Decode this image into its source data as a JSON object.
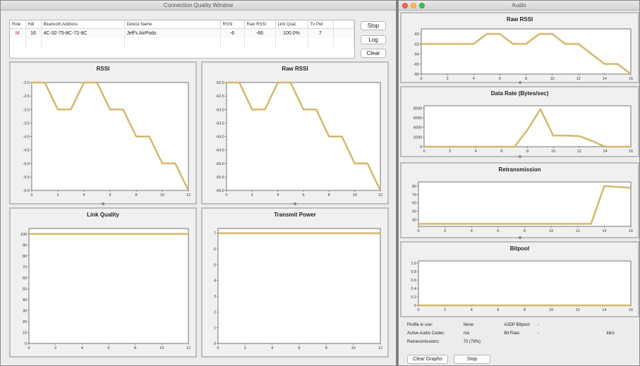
{
  "left_window": {
    "title": "Connection Quality Window",
    "columns": [
      "Role",
      "Hdl",
      "Bluetooth Address",
      "Device Name",
      "RSSI",
      "Raw RSSI",
      "Link Qual.",
      "Tx Pwr"
    ],
    "rows": [
      [
        "M",
        "16",
        "4C-32-75-8C-72-9C",
        "Jeff's AirPods",
        "-6",
        "-66",
        "100.0%",
        "7"
      ]
    ],
    "buttons": {
      "stop": "Stop",
      "log": "Log",
      "clear": "Clear"
    }
  },
  "right_window": {
    "title": "Audio",
    "info": {
      "profile_label": "Profile in use:",
      "profile_value": "None",
      "bitpool_label": "A2DP Bitpool:",
      "bitpool_value": "-",
      "codec_label": "Active Audio Codec:",
      "codec_value": "n/a",
      "bitrate_label": "Bit Rate:",
      "bitrate_value": "-",
      "bitrate_unit": "kb/s",
      "retrans_label": "Retransmissions:",
      "retrans_value": "70 (79%)"
    },
    "buttons": {
      "clear_graphs": "Clear Graphs",
      "stop": "Stop"
    }
  },
  "colors": {
    "line": "#dcc27a",
    "line_core": "#c9a64f"
  },
  "chart_data": [
    {
      "id": "rssi",
      "type": "line",
      "title": "RSSI",
      "x": [
        0,
        1,
        2,
        3,
        4,
        5,
        6,
        7,
        8,
        9,
        10,
        11,
        12
      ],
      "y": [
        -2.0,
        -2.0,
        -3.0,
        -3.0,
        -2.0,
        -2.0,
        -3.0,
        -3.0,
        -4.0,
        -4.0,
        -5.0,
        -5.0,
        -6.0
      ],
      "xlim": [
        0,
        12
      ],
      "ylim": [
        -6.0,
        -2.0
      ],
      "xticks": [
        0,
        2,
        4,
        6,
        8,
        10,
        12
      ],
      "yticks": [
        -2.0,
        -2.5,
        -3.0,
        -3.5,
        -4.0,
        -4.5,
        -5.0,
        -5.5,
        -6.0
      ],
      "ytick_labels": [
        "-2.0",
        "-2.5",
        "-3.0",
        "-3.5",
        "-4.0",
        "-4.5",
        "-5.0",
        "-5.5",
        "-6.0"
      ]
    },
    {
      "id": "rawrssi",
      "type": "line",
      "title": "Raw RSSI",
      "x": [
        0,
        1,
        2,
        3,
        4,
        5,
        6,
        7,
        8,
        9,
        10,
        11,
        12
      ],
      "y": [
        -62,
        -62,
        -63,
        -63,
        -62,
        -62,
        -63,
        -63,
        -64,
        -64,
        -65,
        -65,
        -66
      ],
      "xlim": [
        0,
        12
      ],
      "ylim": [
        -66,
        -62
      ],
      "xticks": [
        0,
        2,
        4,
        6,
        8,
        10,
        12
      ],
      "yticks": [
        -62,
        -62.5,
        -63,
        -63.5,
        -64,
        -64.5,
        -65,
        -65.5,
        -66
      ],
      "ytick_labels": [
        "-62.0",
        "-62.5",
        "-63.0",
        "-63.5",
        "-64.0",
        "-64.5",
        "-65.0",
        "-65.5",
        "-66.0"
      ]
    },
    {
      "id": "linkq",
      "type": "line",
      "title": "Link Quality",
      "x": [
        0,
        12
      ],
      "y": [
        100,
        100
      ],
      "xlim": [
        0,
        12
      ],
      "ylim": [
        0,
        105
      ],
      "xticks": [
        0,
        2,
        4,
        6,
        8,
        10,
        12
      ],
      "yticks": [
        0,
        10,
        20,
        30,
        40,
        50,
        60,
        70,
        80,
        90,
        100
      ],
      "ytick_labels": [
        "0",
        "10",
        "20",
        "30",
        "40",
        "50",
        "60",
        "70",
        "80",
        "90",
        "100"
      ]
    },
    {
      "id": "txpwr",
      "type": "line",
      "title": "Transmit Power",
      "x": [
        0,
        12
      ],
      "y": [
        7,
        7
      ],
      "xlim": [
        0,
        12
      ],
      "ylim": [
        0,
        7.3
      ],
      "xticks": [
        0,
        2,
        4,
        6,
        8,
        10,
        12
      ],
      "yticks": [
        0,
        1,
        2,
        3,
        4,
        5,
        6,
        7
      ],
      "ytick_labels": [
        "0",
        "1",
        "2",
        "3",
        "4",
        "5",
        "6",
        "7"
      ]
    },
    {
      "id": "a_rawrssi",
      "type": "line",
      "title": "Raw RSSI",
      "x": [
        0,
        1,
        2,
        3,
        4,
        5,
        6,
        7,
        8,
        9,
        10,
        11,
        12,
        13,
        14,
        15,
        16
      ],
      "y": [
        -63,
        -63,
        -63,
        -63,
        -63,
        -62,
        -62,
        -63,
        -63,
        -62,
        -62,
        -63,
        -63,
        -64,
        -65,
        -65,
        -66
      ],
      "xlim": [
        0,
        16
      ],
      "ylim": [
        -66,
        -61.5
      ],
      "xticks": [
        0,
        2,
        4,
        6,
        8,
        10,
        12,
        14,
        16
      ],
      "yticks": [
        -62,
        -63,
        -64,
        -65,
        -66
      ],
      "ytick_labels": [
        "-62",
        "-63",
        "-64",
        "-65",
        "-66"
      ]
    },
    {
      "id": "a_datarate",
      "type": "line",
      "title": "Data Rate (Bytes/sec)",
      "x": [
        0,
        7,
        8,
        9,
        10,
        11,
        12,
        13,
        14,
        16
      ],
      "y": [
        0,
        0,
        3500,
        7800,
        2300,
        2300,
        2200,
        1200,
        0,
        0
      ],
      "xlim": [
        0,
        16
      ],
      "ylim": [
        0,
        8500
      ],
      "xticks": [
        0,
        2,
        4,
        6,
        8,
        10,
        12,
        14,
        16
      ],
      "yticks": [
        0,
        2000,
        4000,
        6000,
        8000
      ],
      "ytick_labels": [
        "0",
        "2000",
        "4000",
        "6000",
        "8000"
      ]
    },
    {
      "id": "a_retrans",
      "type": "line",
      "title": "Retransmission",
      "x": [
        0,
        12,
        13,
        14,
        16
      ],
      "y": [
        35,
        35,
        35,
        80,
        78
      ],
      "xlim": [
        0,
        16
      ],
      "ylim": [
        32,
        85
      ],
      "xticks": [
        0,
        2,
        4,
        6,
        8,
        10,
        12,
        14,
        16
      ],
      "yticks": [
        40,
        50,
        60,
        70,
        80
      ],
      "ytick_labels": [
        "40",
        "50",
        "60",
        "70",
        "80"
      ]
    },
    {
      "id": "a_bitpool",
      "type": "line",
      "title": "Bitpool",
      "x": [
        0,
        16
      ],
      "y": [
        0,
        0
      ],
      "xlim": [
        0,
        16
      ],
      "ylim": [
        0,
        1.05
      ],
      "xticks": [
        0,
        2,
        4,
        6,
        8,
        10,
        12,
        14,
        16
      ],
      "yticks": [
        0,
        0.2,
        0.4,
        0.6,
        0.8,
        1.0
      ],
      "ytick_labels": [
        "0",
        "0.2",
        "0.4",
        "0.6",
        "0.8",
        "1.0"
      ]
    }
  ]
}
